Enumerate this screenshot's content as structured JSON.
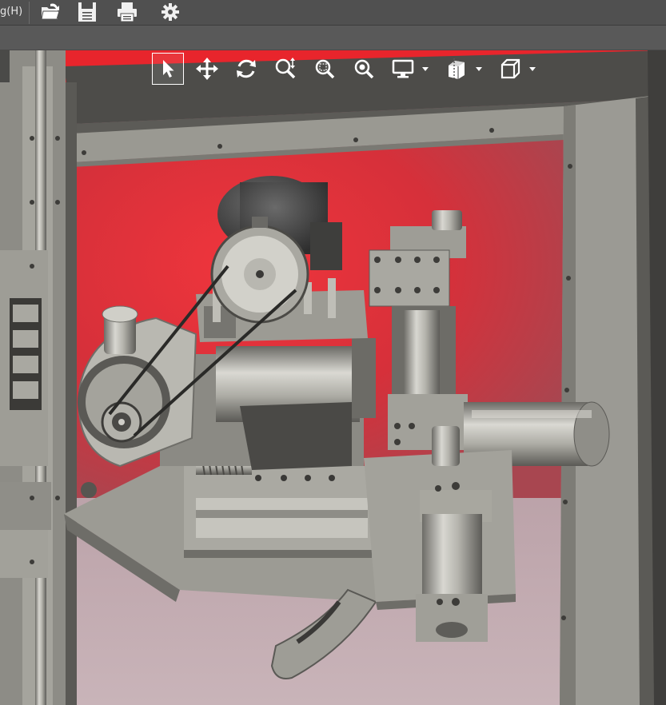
{
  "menu": {
    "help_label": "g(H)"
  },
  "toolbar": {
    "icons": [
      "open-icon",
      "save-icon",
      "print-icon",
      "settings-icon"
    ]
  },
  "view_toolbar": {
    "tools": [
      "select-icon",
      "pan-icon",
      "rotate-icon",
      "zoom-icon",
      "zoom-window-icon",
      "zoom-fit-icon",
      "display-icon",
      "section-icon",
      "view-cube-icon"
    ],
    "active_tool": "select-icon"
  },
  "colors": {
    "background_red": "#ea2d35",
    "machine_gray": "#9a9992",
    "frame_dark": "#4a4a48",
    "ui_dark": "#505050"
  }
}
